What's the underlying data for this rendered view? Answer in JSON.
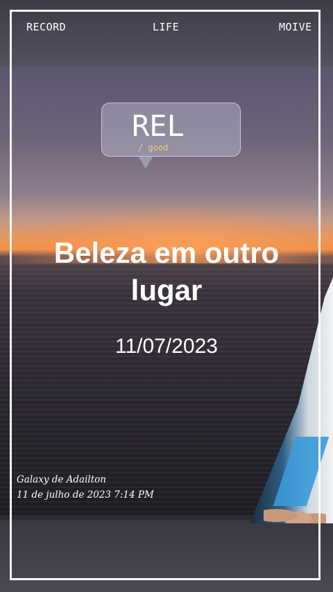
{
  "nav": {
    "record": "RECORD",
    "life": "LIFE",
    "moive": "MOIVE"
  },
  "sticker": {
    "title": "REL",
    "subtitle": "/ good"
  },
  "headline": "Beleza em outro lugar",
  "date": "11/07/2023",
  "watermark": {
    "device": "Galaxy de Adailton",
    "datetime": "11 de julho de 2023 7:14 PM"
  },
  "colors": {
    "frame": "#ffffff",
    "sticker_subtitle": "#f0d070"
  }
}
